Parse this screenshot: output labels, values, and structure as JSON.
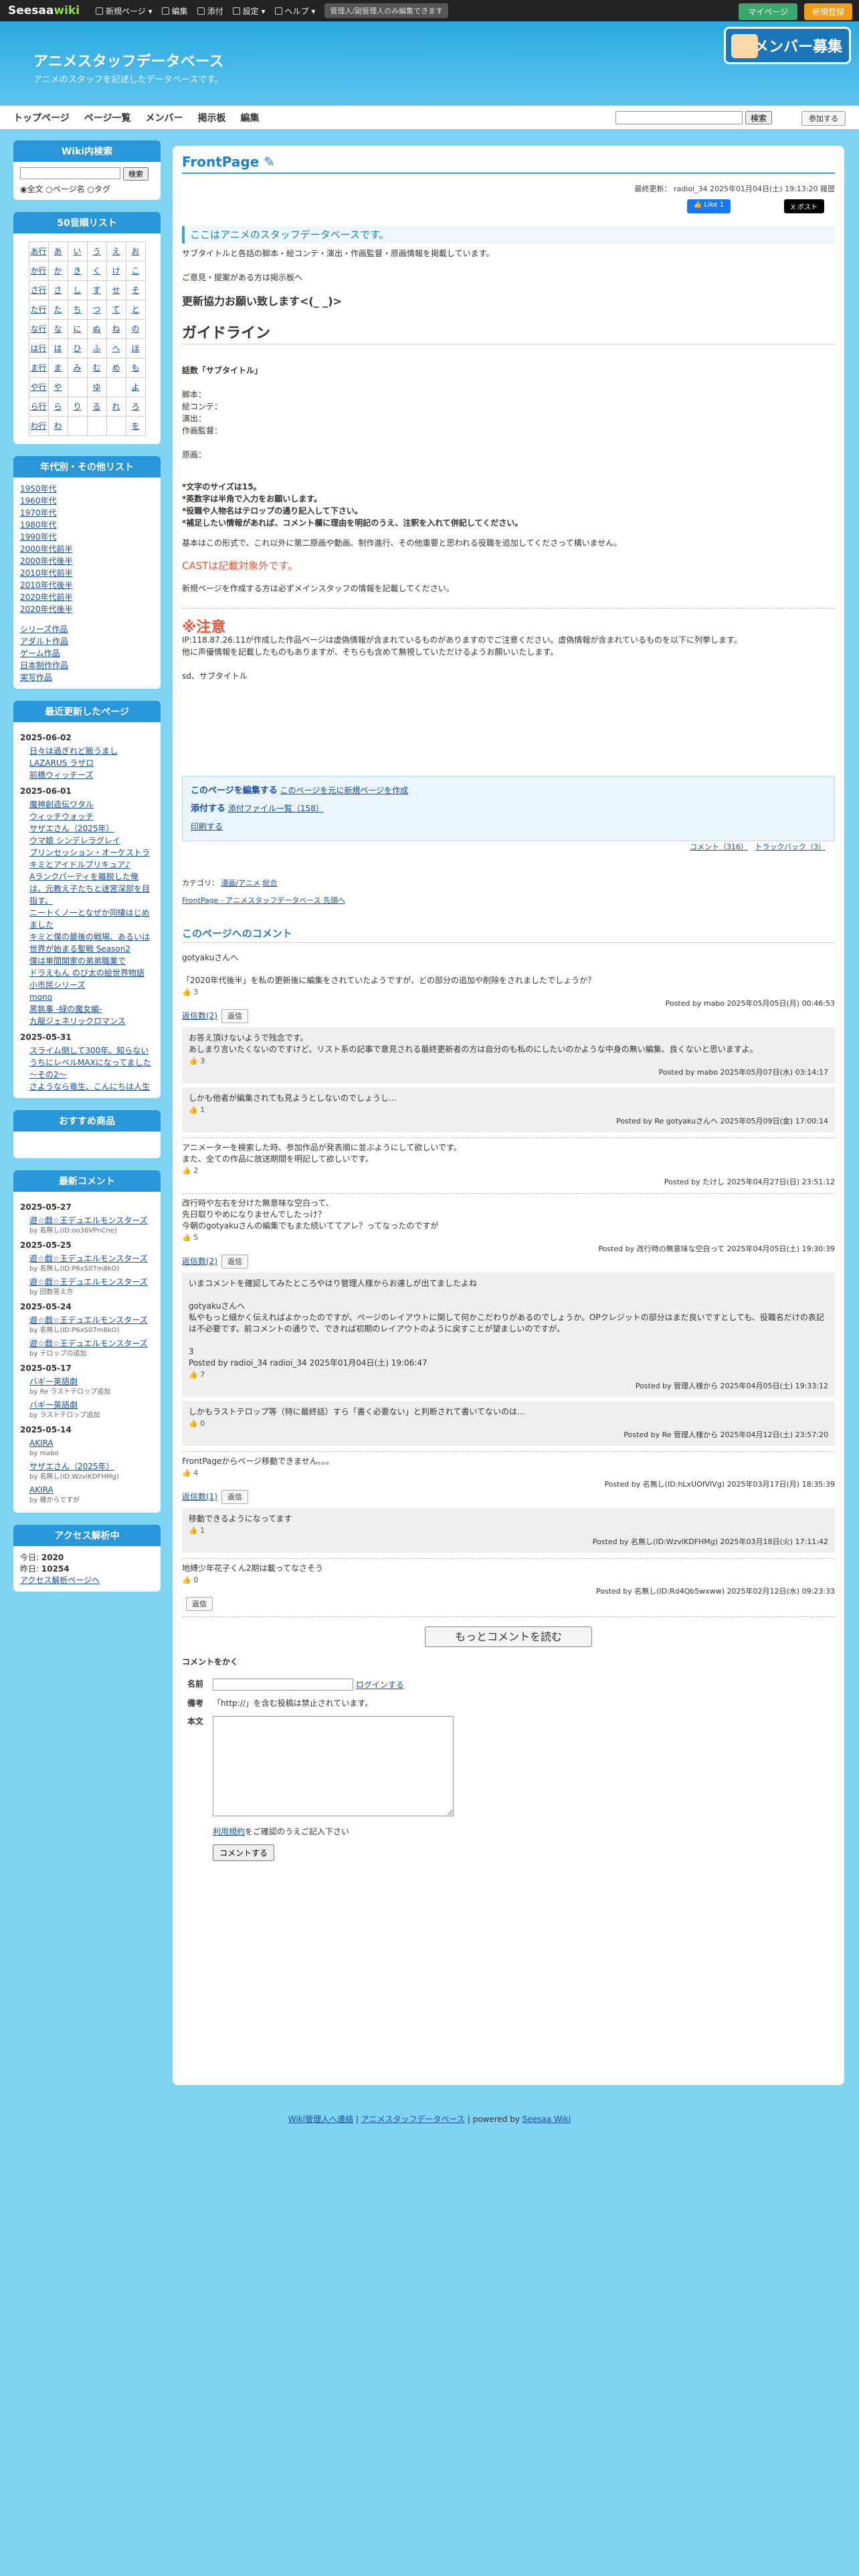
{
  "topbar": {
    "logo_a": "Seesaa",
    "logo_b": "wiki",
    "items": [
      "新規ページ ▾",
      "編集",
      "添付",
      "設定 ▾",
      "ヘルプ ▾"
    ],
    "message": "管理人/副管理人のみ編集できます",
    "mypage": "マイページ",
    "register": "新規登録"
  },
  "header": {
    "title": "アニメスタッフデータベース",
    "subtitle": "アニメのスタッフを記述したデータベースです。",
    "banner": "メンバー募集"
  },
  "nav": {
    "items": [
      "トップページ",
      "ページ一覧",
      "メンバー",
      "掲示板",
      "編集"
    ],
    "search_btn": "検索",
    "join": "参加する"
  },
  "sidebar": {
    "search": {
      "title": "Wiki内検索",
      "btn": "検索",
      "opts": [
        "全文",
        "ページ名",
        "タグ"
      ]
    },
    "kana": {
      "title": "50音順リスト",
      "rows": [
        [
          "あ行",
          "あ",
          "い",
          "う",
          "え",
          "お"
        ],
        [
          "か行",
          "か",
          "き",
          "く",
          "け",
          "こ"
        ],
        [
          "さ行",
          "さ",
          "し",
          "す",
          "せ",
          "そ"
        ],
        [
          "た行",
          "た",
          "ち",
          "つ",
          "て",
          "と"
        ],
        [
          "な行",
          "な",
          "に",
          "ぬ",
          "ね",
          "の"
        ],
        [
          "は行",
          "は",
          "ひ",
          "ふ",
          "へ",
          "ほ"
        ],
        [
          "ま行",
          "ま",
          "み",
          "む",
          "め",
          "も"
        ],
        [
          "や行",
          "や",
          "",
          "ゆ",
          "",
          "よ"
        ],
        [
          "ら行",
          "ら",
          "り",
          "る",
          "れ",
          "ろ"
        ],
        [
          "わ行",
          "わ",
          "",
          "",
          "",
          "を"
        ]
      ]
    },
    "years": {
      "title": "年代別・その他リスト",
      "items": [
        "1950年代",
        "1960年代",
        "1970年代",
        "1980年代",
        "1990年代",
        "2000年代前半",
        "2000年代後半",
        "2010年代前半",
        "2010年代後半",
        "2020年代前半",
        "2020年代後半"
      ],
      "others": [
        "シリーズ作品",
        "アダルト作品",
        "ゲーム作品",
        "日本制作作品",
        "実写作品"
      ]
    },
    "recent": {
      "title": "最近更新したページ",
      "groups": [
        {
          "date": "2025-06-02",
          "pages": [
            "日々は過ぎれど飯うまし",
            "LAZARUS ラザロ",
            "前橋ウィッチーズ"
          ]
        },
        {
          "date": "2025-06-01",
          "pages": [
            "魔神創造伝ワタル",
            "ウィッチウォッチ",
            "サザエさん（2025年）",
            "ウマ娘 シンデレラグレイ",
            "プリンセッション・オーケストラ",
            "キミとアイドルプリキュア♪",
            "Aランクパーティを離脱した俺は、元教え子たちと迷宮深部を目指す。",
            "ニートくノ一となぜか同棲はじめました",
            "キミと僕の最後の戦場、あるいは世界が始まる聖戦 Season2",
            "僕は単間関家の弟弟職業で",
            "ドラえもん のび太の絵世界物語",
            "小市民シリーズ",
            "mono",
            "黒執事 -緑の魔女編-",
            "九龍ジェネリックロマンス"
          ]
        },
        {
          "date": "2025-05-31",
          "pages": [
            "スライム倒して300年、知らないうちにレベルMAXになってました ～その2～",
            "さようなら竜生、こんにちは人生"
          ]
        }
      ]
    },
    "goods": {
      "title": "おすすめ商品"
    },
    "comments": {
      "title": "最新コメント",
      "groups": [
        {
          "date": "2025-05-27",
          "items": [
            {
              "t": "遊☆戯☆王デュエルモンスターズ",
              "by": "by 名無し(ID:oo36VPnCne)"
            }
          ]
        },
        {
          "date": "2025-05-25",
          "items": [
            {
              "t": "遊☆戯☆王デュエルモンスターズ",
              "by": "by 名無し(ID:P6xS07m8kO)"
            },
            {
              "t": "遊☆戯☆王デュエルモンスターズ",
              "by": "by 回数答え方"
            }
          ]
        },
        {
          "date": "2025-05-24",
          "items": [
            {
              "t": "遊☆戯☆王デュエルモンスターズ",
              "by": "by 名無し(ID:P6xS07m8kO)"
            },
            {
              "t": "遊☆戯☆王デュエルモンスターズ",
              "by": "by テロップの追加"
            }
          ]
        },
        {
          "date": "2025-05-17",
          "items": [
            {
              "t": "バギー英語劇",
              "by": "by Re ラストテロップ追加"
            },
            {
              "t": "バギー英語劇",
              "by": "by ラストテロップ追加"
            }
          ]
        },
        {
          "date": "2025-05-14",
          "items": [
            {
              "t": "AKIRA",
              "by": "by mabo"
            },
            {
              "t": "サザエさん（2025年）",
              "by": "by 名無し(ID:WzvlKDFHMg)"
            },
            {
              "t": "AKIRA",
              "by": "by 確からですが"
            }
          ]
        }
      ]
    },
    "access": {
      "title": "アクセス解析中",
      "today_label": "今日:",
      "today": "2020",
      "yesterday_label": "昨日:",
      "yesterday": "10254",
      "link": "アクセス解析ページへ"
    }
  },
  "main": {
    "title": "FrontPage",
    "meta": "最終更新： radioi_34 2025年01月04日(土) 19:13:20 履歴",
    "like": "👍 Like 1",
    "post": "X ポスト",
    "callout": "ここはアニメのスタッフデータベースです。",
    "intro1": "サブタイトルと各話の脚本・絵コンテ・演出・作画監督・原画情報を掲載しています。",
    "intro2": "ご意見・提案がある方は掲示板へ",
    "help": "更新協力お願い致します<(_ _)>",
    "guide": "ガイドライン",
    "format": [
      "話数「サブタイトル」",
      "脚本：",
      "絵コンテ：",
      "演出：",
      "作画監督：",
      "",
      "原画："
    ],
    "rules": [
      "*文字のサイズは15。",
      "*英数字は半角で入力をお願いします。",
      "*役職や人物名はテロップの通り記入して下さい。",
      "*補足したい情報があれば、コメント欄に理由を明記のうえ、注釈を入れて併記してください。"
    ],
    "basic": "基本はこの形式で、これ以外に第二原画や動画、制作進行、その他重要と思われる役職を追加してくださって構いません。",
    "cast": "CASTは記載対象外です。",
    "newpage": "新規ページを作成する方は必ずメインスタッフの情報を記載してください。",
    "warn": "※注意",
    "warn1": "IP:118.87.26.11が作成した作品ページは虚偽情報が含まれているものがありますのでご注意ください。虚偽情報が含まれているものを以下に列挙します。",
    "warn2": "他に声優情報を記載したものもありますが、そちらも含めて無視していただけるようお願いいたします。",
    "sd": "sd、サブタイトル",
    "edit": "このページを編集する",
    "edit2": "このページを元に新規ページを作成",
    "attach": "添付する",
    "attach2": "添付ファイル一覧（158）",
    "print": "印刷する",
    "comment_link": "コメント（316）",
    "trackback": "トラックバック（3）",
    "category": "カテゴリ：",
    "cat1": "漫画/アニメ",
    "cat2": "総合",
    "breadcrumb": "FrontPage - アニメスタッフデータベース 先頭へ"
  },
  "comments": {
    "title": "このページへのコメント",
    "list": [
      {
        "text": "gotyakuさんへ\n\n「2020年代後半」を私の更新後に編集をされていたようですが、どの部分の追加や削除をされましたでしょうか？",
        "likes": "3",
        "posted": "Posted by mabo 2025年05月05日(月) 00:46:53",
        "replies_label": "返信数(2)",
        "reply_btn": "返信",
        "replies": [
          {
            "text": "お答え頂けないようで残念です。\nあしまり言いたくないのですけど、リスト系の記事で意見される最終更新者の方は自分のも私のにしたいのかような中身の無い編集、良くないと思いますよ。",
            "likes": "3",
            "posted": "Posted by mabo 2025年05月07日(水) 03:14:17"
          },
          {
            "text": "しかも他者が編集されても見ようとしないのでしょうし…",
            "likes": "1",
            "posted": "Posted by Re gotyakuさんへ 2025年05月09日(金) 17:00:14"
          }
        ]
      },
      {
        "text": "アニメーターを検索した時、参加作品が発表順に並ぶようにして欲しいです。\nまた、全ての作品に放送期間を明記して欲しいです。",
        "likes": "2",
        "posted": "Posted by たけし 2025年04月27日(日) 23:51:12",
        "replies_label": "",
        "reply_btn": "",
        "replies": []
      },
      {
        "text": "改行時や左右を分けた無意味な空白って、\n先日取りやめになりませんでしたっけ？\n今朝のgotyakuさんの編集でもまた続いててアレ？ってなったのですが",
        "likes": "5",
        "posted": "Posted by 改行時の無意味な空白って 2025年04月05日(土) 19:30:39",
        "replies_label": "返信数(2)",
        "reply_btn": "返信",
        "replies": [
          {
            "text": "いまコメントを確認してみたところやはり管理人様からお達しが出てましたよね\n\ngotyakuさんへ\n私やもっと細かく伝えればよかったのですが、ページのレイアウトに関して何かこだわりがあるのでしょうか。OPクレジットの部分はまだ良いですとしても、役職名だけの表記は不必要です。前コメントの通りで、できれば初期のレイアウトのように戻すことが望ましいのですが。\n\n3\nPosted by radioi_34 radioi_34 2025年01月04日(土) 19:06:47",
            "likes": "7",
            "posted": "Posted by 管理人様から 2025年04月05日(土) 19:33:12"
          },
          {
            "text": "しかもラストテロップ等（特に最終話）すら「書く必要ない」と判断されて書いてないのは…",
            "likes": "0",
            "posted": "Posted by Re 管理人様から 2025年04月12日(土) 23:57:20"
          }
        ]
      },
      {
        "text": "FrontPageからページ移動できません。。。",
        "likes": "4",
        "posted": "Posted by 名無し(ID:hLxUOfVlVg) 2025年03月17日(月) 18:35:39",
        "replies_label": "返信数(1)",
        "reply_btn": "返信",
        "replies": [
          {
            "text": "移動できるようになってます",
            "likes": "1",
            "posted": "Posted by 名無し(ID:WzvlKDFHMg) 2025年03月18日(火) 17:11:42"
          }
        ]
      },
      {
        "text": "地縛少年花子くん2期は載ってなさそう",
        "likes": "0",
        "posted": "Posted by 名無し(ID:Rd4Qb5wxww) 2025年02月12日(水) 09:23:33",
        "replies_label": "",
        "reply_btn": "返信",
        "replies": []
      }
    ],
    "more": "もっとコメントを読む",
    "form": {
      "title": "コメントをかく",
      "name": "名前",
      "login": "ログインする",
      "remarks": "備考",
      "remarks_text": "「http://」を含む投稿は禁止されています。",
      "body": "本文",
      "terms": "利用規約",
      "terms_text": "をご確認のうえご記入下さい",
      "submit": "コメントする"
    }
  },
  "footer": {
    "a": "Wiki管理人へ連絡",
    "b": "アニメスタッフデータベース",
    "c": "powered by",
    "d": "Seesaa Wiki"
  }
}
